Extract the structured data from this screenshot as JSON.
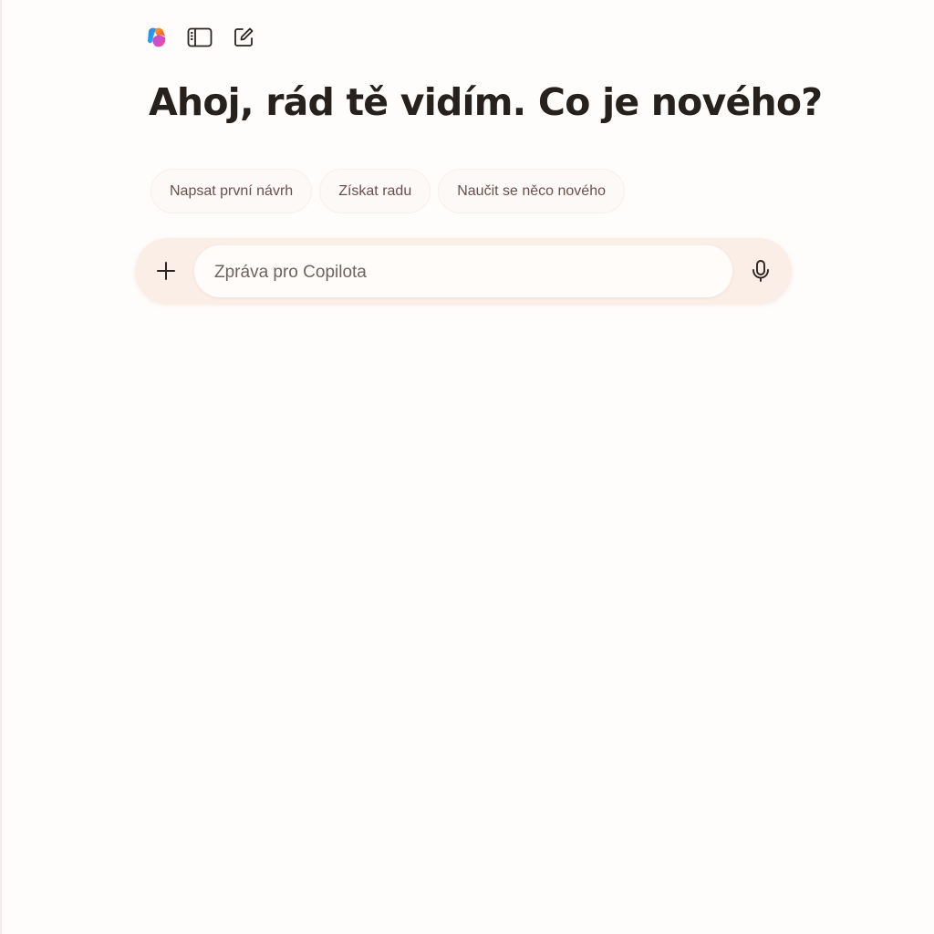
{
  "app": {
    "name": "Copilot",
    "greeting": "Ahoj, rád tě vidím. Co je nového?"
  },
  "toolbar": {
    "icons": [
      "copilot-logo-icon",
      "sidebar-toggle-icon",
      "new-chat-icon"
    ]
  },
  "suggestions": [
    {
      "label": "Napsat první návrh"
    },
    {
      "label": "Získat radu"
    },
    {
      "label": "Naučit se něco nového"
    }
  ],
  "composer": {
    "placeholder": "Zpráva pro Copilota",
    "value": "",
    "add_icon": "plus-icon",
    "voice_icon": "microphone-icon"
  },
  "colors": {
    "background": "#fffdfc",
    "composer_bg": "#fbeee7",
    "chip_text": "#6a5048",
    "heading": "#27211e"
  }
}
